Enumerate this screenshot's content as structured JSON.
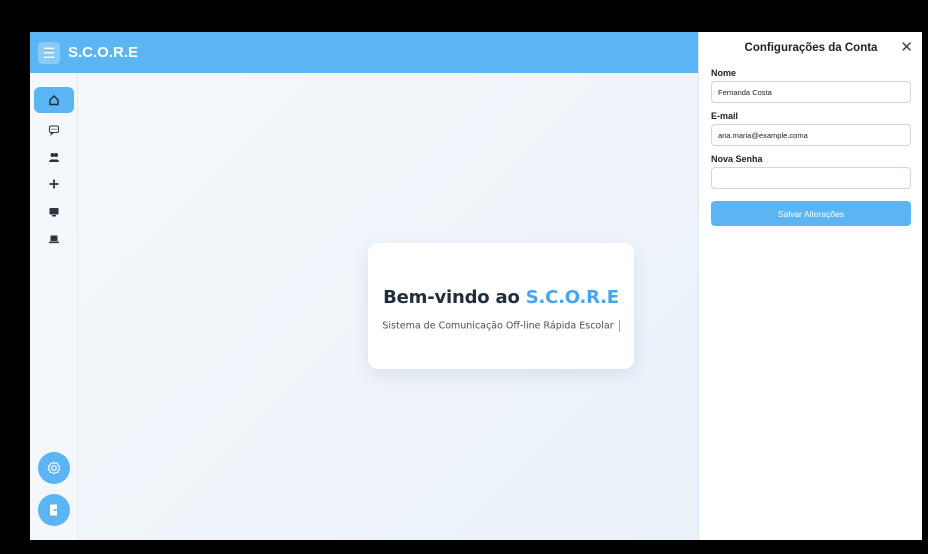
{
  "header": {
    "menu_icon": "hamburger-icon",
    "app_title": "S.C.O.R.E"
  },
  "sidebar": {
    "items": [
      {
        "name": "home",
        "icon": "home-icon",
        "active": true
      },
      {
        "name": "messages",
        "icon": "chat-icon",
        "active": false
      },
      {
        "name": "users",
        "icon": "users-icon",
        "active": false
      },
      {
        "name": "add",
        "icon": "plus-icon",
        "active": false
      },
      {
        "name": "monitor",
        "icon": "monitor-icon",
        "active": false
      },
      {
        "name": "laptop",
        "icon": "laptop-icon",
        "active": false
      }
    ],
    "settings_icon": "gear-icon",
    "logout_icon": "logout-icon"
  },
  "welcome": {
    "title_prefix": "Bem-vindo ao ",
    "title_accent": "S.C.O.R.E",
    "subtitle": "Sistema de Comunicação Off-line Rápida Escolar"
  },
  "settings_panel": {
    "title": "Configurações da Conta",
    "close_label": "✕",
    "name_label": "Nome",
    "name_value": "Fernanda Costa",
    "email_label": "E-mail",
    "email_value": "ana.maria@example.coma",
    "password_label": "Nova Senha",
    "password_value": "",
    "save_label": "Salvar Alterações"
  },
  "colors": {
    "accent": "#5bb5f5",
    "title_accent": "#42a5f5",
    "frame_bg": "#000000"
  }
}
